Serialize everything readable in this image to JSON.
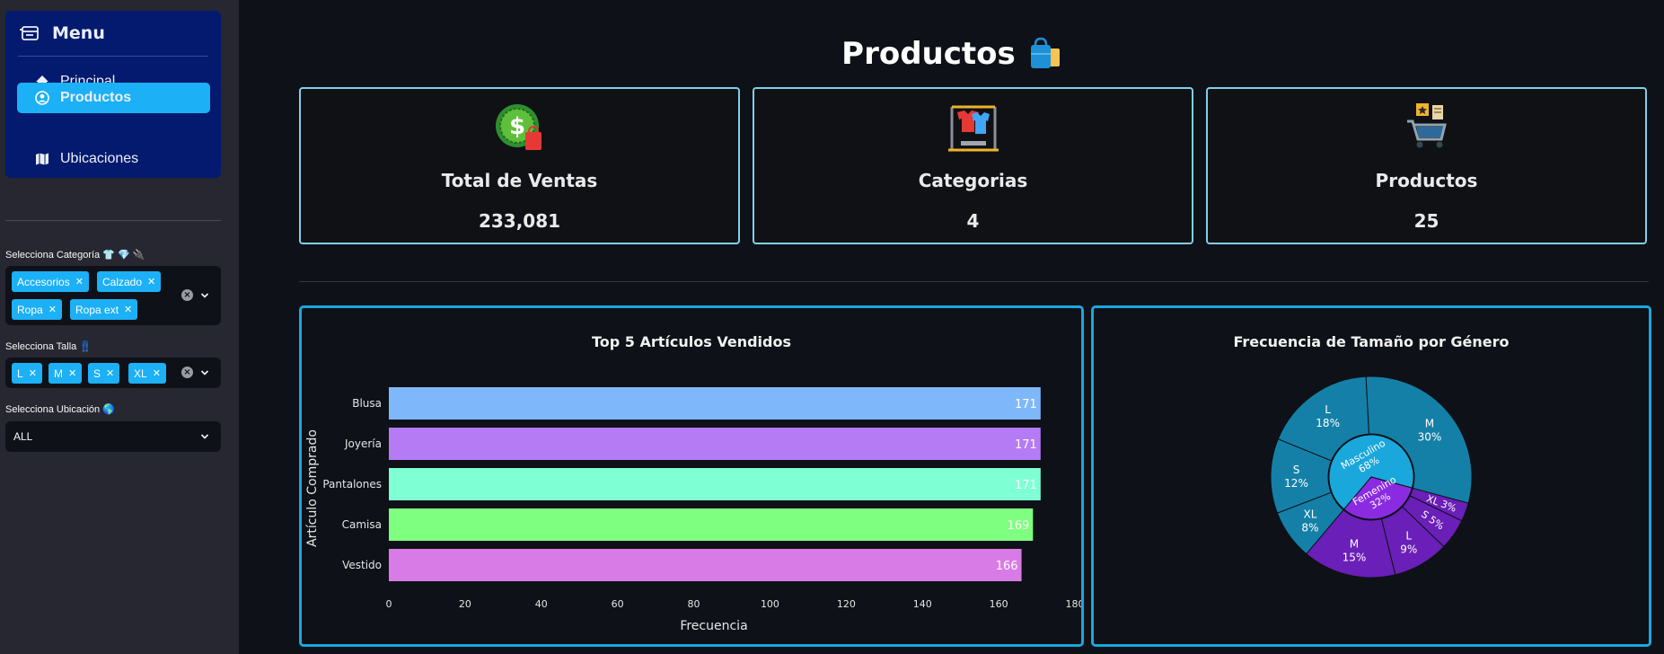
{
  "sidebar": {
    "menu_title": "Menu",
    "items": [
      {
        "label": "Principal",
        "icon": "house-icon",
        "active": false
      },
      {
        "label": "Productos",
        "icon": "person-circle-icon",
        "active": true
      },
      {
        "label": "Ubicaciones",
        "icon": "map-icon",
        "active": false
      }
    ],
    "filters": {
      "category": {
        "label": "Selecciona Categoría 👕 💎 🔌",
        "selected": [
          "Accesorios",
          "Calzado",
          "Ropa",
          "Ropa ext"
        ]
      },
      "size": {
        "label": "Selecciona Talla 👖",
        "selected": [
          "L",
          "M",
          "S",
          "XL"
        ]
      },
      "location": {
        "label": "Selecciona Ubicación 🌎",
        "value": "ALL"
      }
    }
  },
  "page": {
    "title": "Productos",
    "title_emoji": "🛍️"
  },
  "cards": [
    {
      "label": "Total de Ventas",
      "value": "233,081",
      "icon": "money-bag-icon"
    },
    {
      "label": "Categorias",
      "value": "4",
      "icon": "clothing-rack-icon"
    },
    {
      "label": "Productos",
      "value": "25",
      "icon": "shopping-cart-icon"
    }
  ],
  "colors": {
    "accent": "#1cb0f6",
    "menu_bg": "#031a6e",
    "sidebar_bg": "#262730",
    "page_bg": "#0e1117",
    "card_border": "#7fd0ea",
    "panel_border": "#19a7e0"
  },
  "chart_data": [
    {
      "type": "bar",
      "orientation": "horizontal",
      "title": "Top 5 Artículos Vendidos",
      "xlabel": "Frecuencia",
      "ylabel": "Artículo Comprado",
      "categories": [
        "Blusa",
        "Joyería",
        "Pantalones",
        "Camisa",
        "Vestido"
      ],
      "values": [
        171,
        171,
        171,
        169,
        166
      ],
      "colors": [
        "#7fb8fa",
        "#b57bf5",
        "#7fffd4",
        "#7fff7f",
        "#d97be6"
      ],
      "xlim": [
        0,
        180
      ],
      "xticks": [
        0,
        20,
        40,
        60,
        80,
        100,
        120,
        140,
        160,
        180
      ],
      "grid": false
    },
    {
      "type": "sunburst",
      "title": "Frecuencia de Tamaño por Género",
      "inner": [
        {
          "name": "Masculino",
          "percent": 68,
          "label": "68%",
          "color": "#1aa7dc"
        },
        {
          "name": "Femenino",
          "percent": 32,
          "label": "32%",
          "color": "#8a2be2"
        }
      ],
      "outer": [
        {
          "parent": "Masculino",
          "name": "M",
          "percent": 30,
          "label": "30%",
          "color": "#1480a8"
        },
        {
          "parent": "Masculino",
          "name": "L",
          "percent": 18,
          "label": "18%",
          "color": "#1480a8"
        },
        {
          "parent": "Masculino",
          "name": "S",
          "percent": 12,
          "label": "12%",
          "color": "#1480a8"
        },
        {
          "parent": "Masculino",
          "name": "XL",
          "percent": 8,
          "label": "8%",
          "color": "#1480a8"
        },
        {
          "parent": "Femenino",
          "name": "M",
          "percent": 15,
          "label": "15%",
          "color": "#6a1fb8"
        },
        {
          "parent": "Femenino",
          "name": "L",
          "percent": 9,
          "label": "9%",
          "color": "#6a1fb8"
        },
        {
          "parent": "Femenino",
          "name": "S",
          "percent": 5,
          "label": "5%",
          "color": "#6a1fb8"
        },
        {
          "parent": "Femenino",
          "name": "XL",
          "percent": 3,
          "label": "3%",
          "color": "#6a1fb8"
        }
      ]
    }
  ]
}
